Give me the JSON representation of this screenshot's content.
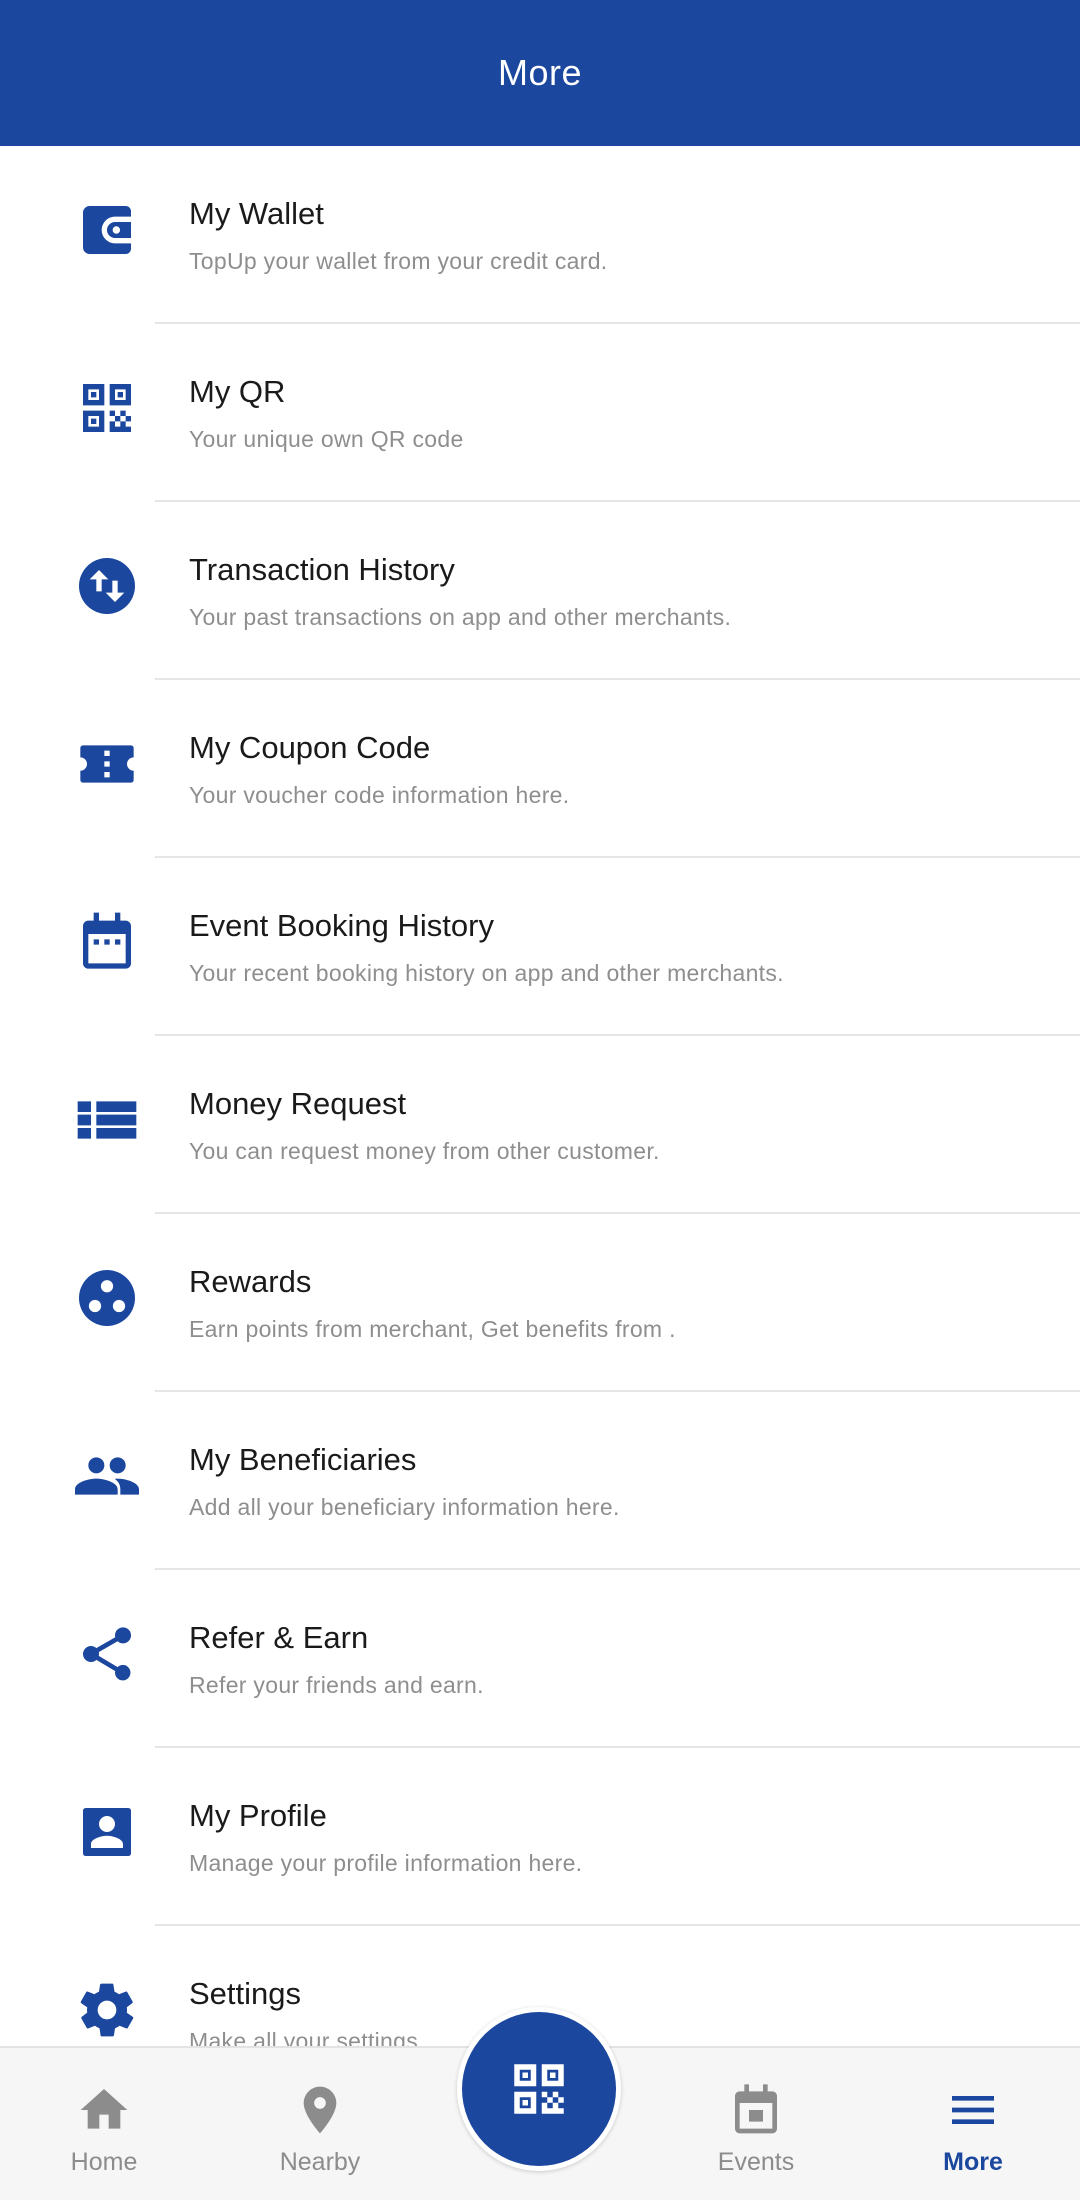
{
  "header": {
    "title": "More"
  },
  "menu": {
    "items": [
      {
        "title": "My Wallet",
        "subtitle": "TopUp your wallet from your credit card.",
        "icon": "wallet-icon"
      },
      {
        "title": "My QR",
        "subtitle": "Your unique own QR code",
        "icon": "qr-code-icon"
      },
      {
        "title": "Transaction History",
        "subtitle": "Your past transactions on app and other merchants.",
        "icon": "swap-vertical-icon"
      },
      {
        "title": "My Coupon Code",
        "subtitle": "Your voucher code information here.",
        "icon": "ticket-icon"
      },
      {
        "title": "Event Booking History",
        "subtitle": "Your recent booking history on app and other merchants.",
        "icon": "calendar-icon"
      },
      {
        "title": "Money Request",
        "subtitle": "You can request money from other customer.",
        "icon": "list-icon"
      },
      {
        "title": "Rewards",
        "subtitle": "Earn points from merchant, Get benefits from .",
        "icon": "rewards-icon"
      },
      {
        "title": "My Beneficiaries",
        "subtitle": "Add all your beneficiary information here.",
        "icon": "people-icon"
      },
      {
        "title": "Refer & Earn",
        "subtitle": "Refer your friends and earn.",
        "icon": "share-icon"
      },
      {
        "title": "My Profile",
        "subtitle": "Manage your profile information here.",
        "icon": "profile-card-icon"
      },
      {
        "title": "Settings",
        "subtitle": "Make all your settings.",
        "icon": "gear-icon"
      }
    ]
  },
  "bottom_nav": {
    "items": [
      {
        "label": "Home",
        "icon": "home-icon"
      },
      {
        "label": "Nearby",
        "icon": "location-pin-icon"
      },
      {
        "label": "Events",
        "icon": "calendar-icon"
      },
      {
        "label": "More",
        "icon": "menu-icon",
        "active": true
      }
    ],
    "scan_icon": "qr-scan-icon"
  },
  "colors": {
    "primary": "#1b479e",
    "title_text": "#1a1a1a",
    "subtitle_text": "#8e8e8e",
    "nav_inactive": "#8c8c8c",
    "nav_background": "#f6f6f6"
  }
}
